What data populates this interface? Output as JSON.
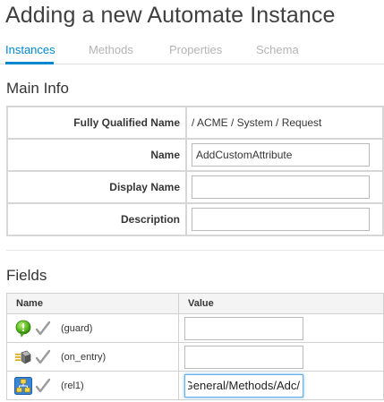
{
  "header": {
    "title": "Adding a new Automate Instance"
  },
  "tabs": [
    {
      "label": "Instances",
      "active": true
    },
    {
      "label": "Methods",
      "active": false
    },
    {
      "label": "Properties",
      "active": false
    },
    {
      "label": "Schema",
      "active": false
    }
  ],
  "main_info": {
    "section_title": "Main Info",
    "rows": [
      {
        "label": "Fully Qualified Name",
        "value": "/ ACME / System / Request"
      },
      {
        "label": "Name",
        "value": "AddCustomAttribute"
      },
      {
        "label": "Display Name",
        "value": ""
      },
      {
        "label": "Description",
        "value": ""
      }
    ]
  },
  "fields": {
    "section_title": "Fields",
    "columns": [
      "Name",
      "Value"
    ],
    "rows": [
      {
        "icon": "guard-icon",
        "name": "(guard)",
        "value": ""
      },
      {
        "icon": "on-entry-icon",
        "name": "(on_entry)",
        "value": ""
      },
      {
        "icon": "relationship-icon",
        "name": "(rel1)",
        "value": "/General/Methods/Adc"
      }
    ]
  },
  "colors": {
    "accent": "#0088ce",
    "focus": "#66afe9"
  }
}
